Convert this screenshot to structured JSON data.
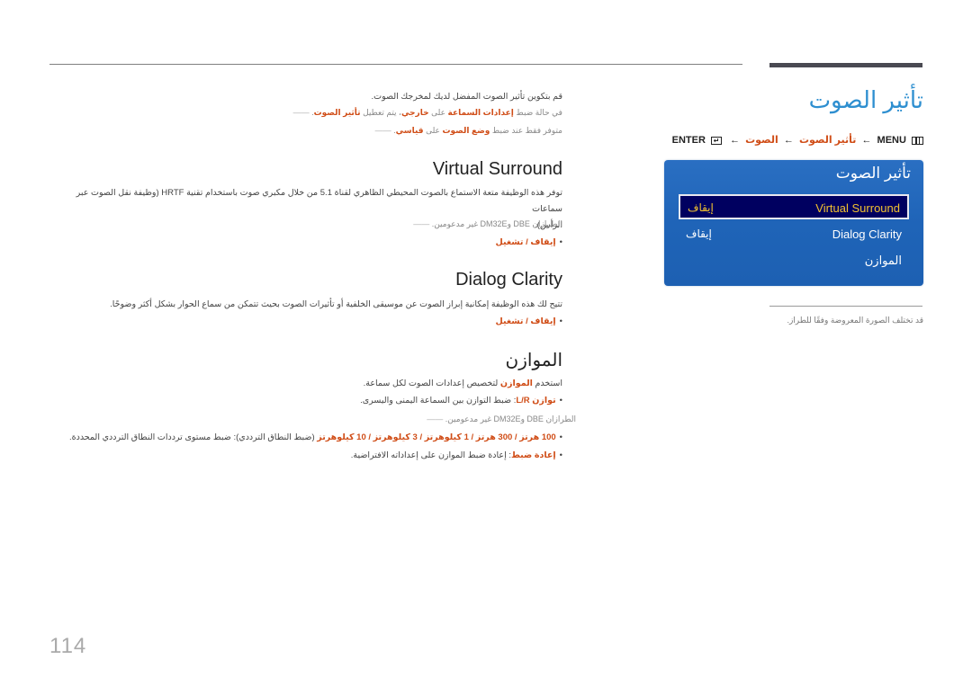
{
  "page": {
    "title": "تأثير الصوت",
    "number": "114"
  },
  "breadcrumb": {
    "menu_label": "MENU",
    "step1": "الصوت",
    "step2": "تأثير الصوت",
    "enter_label": "ENTER",
    "arrow": "←"
  },
  "osd": {
    "title": "تأثير الصوت",
    "items": [
      {
        "name": "Virtual Surround",
        "value": "إيقاف",
        "selected": true
      },
      {
        "name": "Dialog Clarity",
        "value": "إيقاف",
        "selected": false
      },
      {
        "name": "الموازن",
        "value": "",
        "selected": false
      }
    ],
    "note": "قد تختلف الصورة المعروضة وفقًا للطراز."
  },
  "intro": {
    "text": "قم بتكوين تأثير الصوت المفضل لديك لمخرجك الصوت.",
    "note1": {
      "pre": "في حالة ضبط",
      "hl1": "إعدادات السماعة",
      "mid": "على",
      "hl2": "خارجي",
      "mid2": "، يتم تعطيل",
      "hl3": "تأثير الصوت",
      "post": "."
    },
    "note2": {
      "pre": "متوفر فقط عند ضبط",
      "hl1": "وضع الصوت",
      "mid": "على",
      "hl2": "قياسي",
      "post": "."
    }
  },
  "virtual_surround": {
    "heading": "Virtual Surround",
    "line1": "توفر هذه الوظيفة متعة الاستماع بالصوت المحيطي الظاهري لقناة 5.1 من خلال مكبري صوت باستخدام تقنية HRTF (وظيفة نقل الصوت عبر سماعات",
    "line2": "الرأس).",
    "note": "الطرازان DBE وDM32E غير مدعومين.",
    "options": {
      "off": "إيقاف",
      "sep": " / ",
      "on": "تشغيل"
    }
  },
  "dialog_clarity": {
    "heading": "Dialog Clarity",
    "text": "تتيح لك هذه الوظيفة إمكانية إبراز الصوت عن موسيقى الخلفية أو تأثيرات الصوت بحيث تتمكن من سماع الحوار بشكل أكثر وضوحًا.",
    "options": {
      "off": "إيقاف",
      "sep": " / ",
      "on": "تشغيل"
    }
  },
  "equalizer": {
    "heading": "الموازن",
    "intro": {
      "pre": "استخدم",
      "hl": "الموازن",
      "post": "لتخصيص إعدادات الصوت لكل سماعة."
    },
    "balance": {
      "hl": "توازن L/R",
      "text": ": ضبط التوازن بين السماعة اليمنى واليسرى."
    },
    "note": "الطرازان DBE وDM32E غير مدعومين.",
    "bands": {
      "hl": "100 هرتز / 300 هرتز / 1 كيلوهرتز / 3 كيلوهرتز / 10 كيلوهرتز",
      "text": " (ضبط النطاق الترددي): ضبط مستوى ترددات النطاق الترددي المحددة."
    },
    "reset": {
      "hl": "إعادة ضبط",
      "text": ": إعادة ضبط الموازن على إعداداته الافتراضية."
    }
  }
}
